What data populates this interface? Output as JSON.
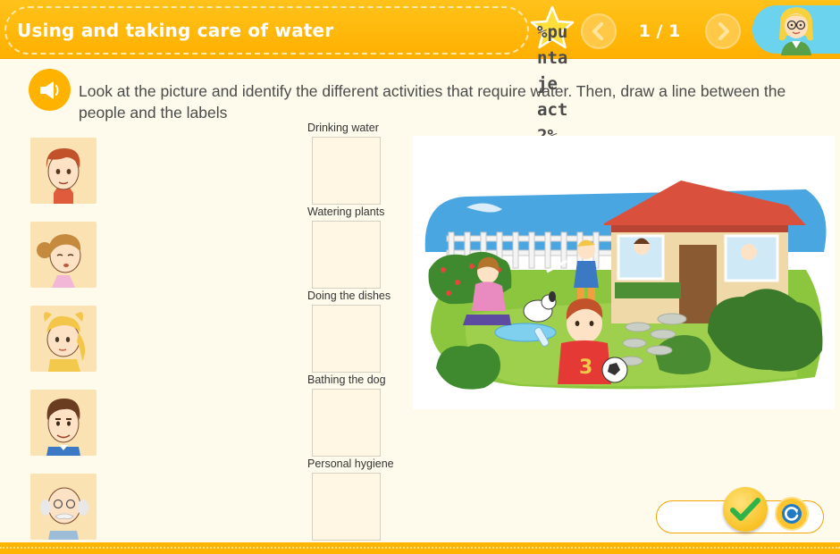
{
  "header": {
    "title": "Using and taking care of water",
    "score_overlay": "%puntaje act 2%",
    "page_counter": "1 / 1",
    "prev_icon": "arrow-left-icon",
    "next_icon": "arrow-right-icon"
  },
  "instruction": {
    "text": "Look at the picture and identify the different activities that require water. Then, draw a line between the people and the labels",
    "icon": "speaker-icon"
  },
  "people": [
    "boy",
    "girl-with-bun",
    "blonde-girl",
    "man",
    "grandfather"
  ],
  "activities": [
    {
      "label": "Drinking water"
    },
    {
      "label": "Watering plants"
    },
    {
      "label": "Doing the dishes"
    },
    {
      "label": "Bathing the dog"
    },
    {
      "label": "Personal hygiene"
    }
  ],
  "footer": {
    "check_icon": "checkmark-icon",
    "reset_icon": "refresh-icon"
  },
  "colors": {
    "header": "#ffb400",
    "background": "#fffbec",
    "accent_blue": "#6cd3ef",
    "check_green": "#2db34a"
  }
}
